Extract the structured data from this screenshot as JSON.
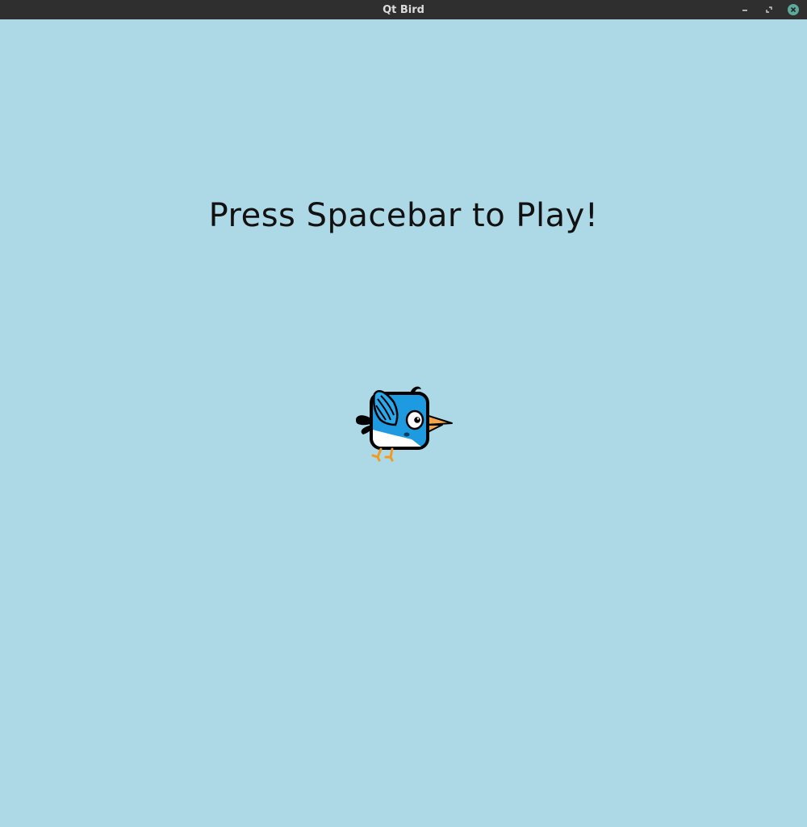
{
  "window": {
    "title": "Qt Bird",
    "controls": {
      "minimize_icon": "minimize-icon",
      "maximize_icon": "maximize-icon",
      "close_icon": "close-icon"
    }
  },
  "game": {
    "prompt": "Press Spacebar to Play!",
    "sprite": "bird-sprite",
    "colors": {
      "sky": "#add8e6",
      "bird_body": "#1e9be0",
      "bird_belly": "#ffffff",
      "beak": "#f5a64a",
      "feet": "#f39a1e",
      "outline": "#000000"
    }
  }
}
